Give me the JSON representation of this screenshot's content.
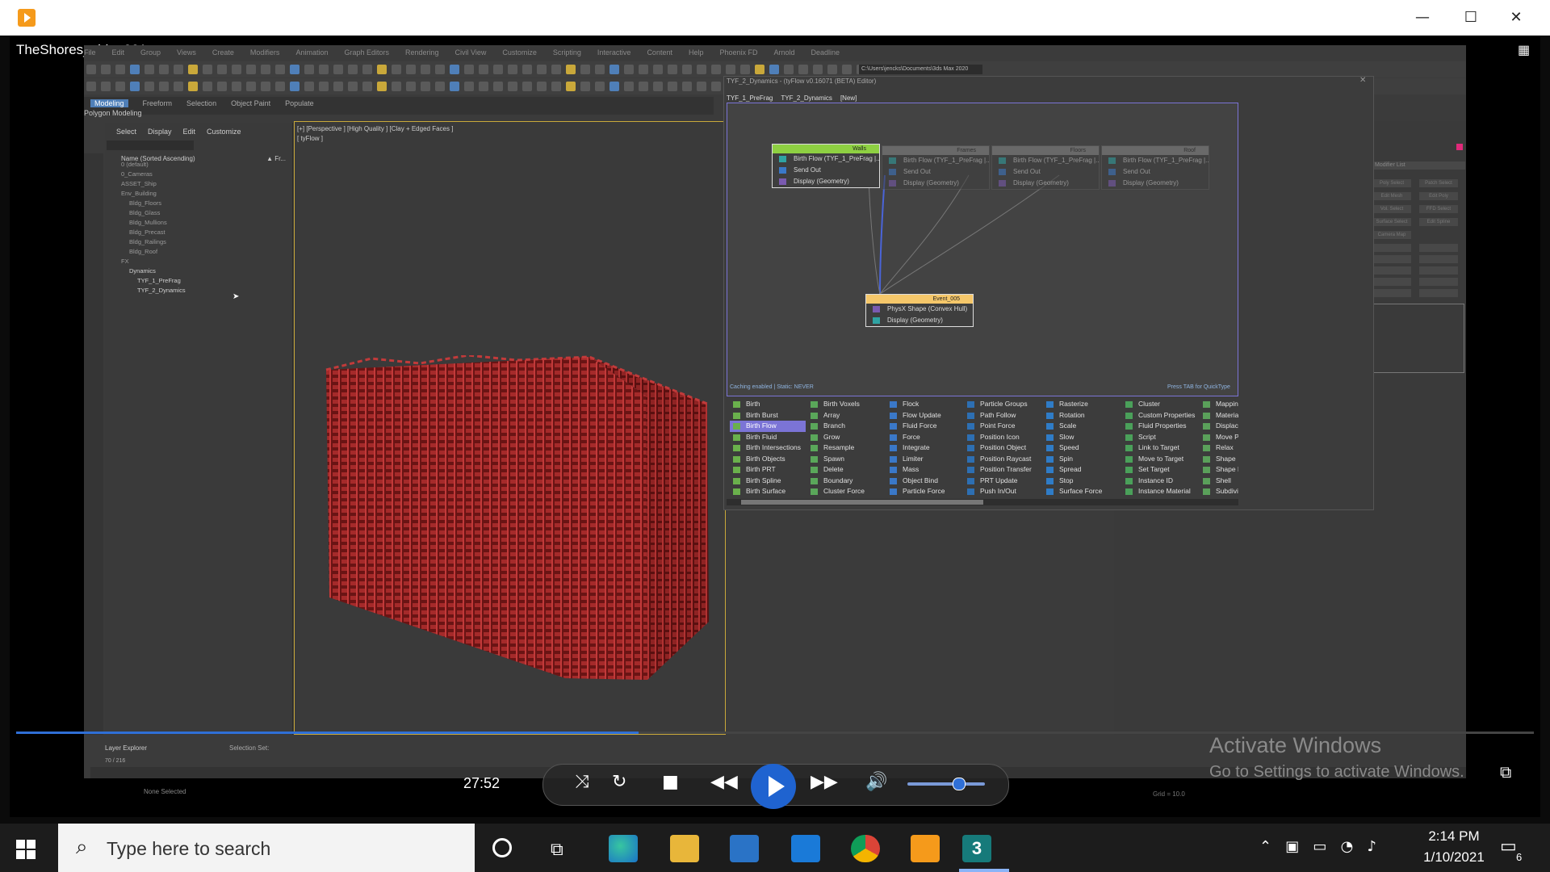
{
  "window": {
    "minimize": "—",
    "maximize": "☐",
    "close": "✕"
  },
  "video": {
    "title": "TheShores_video001",
    "time": "27:52",
    "progress_fraction": 0.41
  },
  "max": {
    "menu": [
      "File",
      "Edit",
      "Group",
      "Views",
      "Create",
      "Modifiers",
      "Animation",
      "Graph Editors",
      "Rendering",
      "Civil View",
      "Customize",
      "Scripting",
      "Interactive",
      "Content",
      "Help",
      "Phoenix FD",
      "Arnold",
      "Deadline"
    ],
    "ribbon": [
      "Modeling",
      "Freeform",
      "Selection",
      "Object Paint",
      "Populate"
    ],
    "polygon_modeling": "Polygon Modeling",
    "path": "C:\\Users\\jencks\\Documents\\3ds Max 2020",
    "scene_explorer": {
      "tabs": [
        "Select",
        "Display",
        "Edit",
        "Customize"
      ],
      "header": "Name (Sorted Ascending)",
      "header_right": "▲ Fr...",
      "rows": [
        "0 (default)",
        "0_Cameras",
        "ASSET_Ship",
        "Env_Building",
        "Bldg_Floors",
        "Bldg_Glass",
        "Bldg_Mullions",
        "Bldg_Precast",
        "Bldg_Railings",
        "Bldg_Roof",
        "FX",
        "Dynamics",
        "TYF_1_PreFrag",
        "TYF_2_Dynamics"
      ]
    },
    "viewport_label": "[+] [Perspective ] [High Quality ] [Clay + Edged Faces ]",
    "viewport_sub": "[ tyFlow ]",
    "right_panel": {
      "modifier_list": "Modifier List",
      "buttons": [
        "Poly Select",
        "Patch Select",
        "Edit Mesh",
        "Edit Poly",
        "Vol. Select",
        "FFD Select",
        "Surface Select",
        "Edit Spline",
        "Camera Map"
      ]
    },
    "layer_explorer": "Layer Explorer",
    "selection_set": "Selection Set:",
    "frame_counter": "70 / 216",
    "status": "None Selected",
    "grid": "Grid = 10.0"
  },
  "tyflow": {
    "title": "TYF_2_Dynamics - (tyFlow v0.16071 (BETA) Editor)",
    "tabs": [
      "TYF_1_PreFrag",
      "TYF_2_Dynamics",
      "[New]"
    ],
    "nodes": [
      {
        "name": "Walls",
        "ops": [
          "Birth Flow (TYF_1_PreFrag |...",
          "Send Out",
          "Display (Geometry)"
        ]
      },
      {
        "name": "Frames",
        "ops": [
          "Birth Flow (TYF_1_PreFrag |...",
          "Send Out",
          "Display (Geometry)"
        ]
      },
      {
        "name": "Floors",
        "ops": [
          "Birth Flow (TYF_1_PreFrag |...",
          "Send Out",
          "Display (Geometry)"
        ]
      },
      {
        "name": "Roof",
        "ops": [
          "Birth Flow (TYF_1_PreFrag |...",
          "Send Out",
          "Display (Geometry)"
        ]
      },
      {
        "name": "Event_005",
        "ops": [
          "PhysX Shape (Convex Hull)",
          "Display (Geometry)"
        ]
      }
    ],
    "status": "Caching enabled | Static: NEVER",
    "hint": "Press TAB for QuickType",
    "depot": [
      [
        "Birth",
        "Birth Burst",
        "Birth Flow",
        "Birth Fluid",
        "Birth Intersections",
        "Birth Objects",
        "Birth PRT",
        "Birth Spline",
        "Birth Surface"
      ],
      [
        "Birth Voxels",
        "Array",
        "Branch",
        "Grow",
        "Resample",
        "Spawn",
        "Delete",
        "Boundary",
        "Cluster Force"
      ],
      [
        "Flock",
        "Flow Update",
        "Fluid Force",
        "Force",
        "Integrate",
        "Limiter",
        "Mass",
        "Object Bind",
        "Particle Force"
      ],
      [
        "Particle Groups",
        "Path Follow",
        "Point Force",
        "Position Icon",
        "Position Object",
        "Position Raycast",
        "Position Transfer",
        "PRT Update",
        "Push In/Out"
      ],
      [
        "Rasterize",
        "Rotation",
        "Scale",
        "Slow",
        "Speed",
        "Spin",
        "Spread",
        "Stop",
        "Surface Force"
      ],
      [
        "Cluster",
        "Custom Properties",
        "Fluid Properties",
        "Script",
        "Link to Target",
        "Move to Target",
        "Set Target",
        "Instance ID",
        "Instance Material"
      ],
      [
        "Mapping",
        "Material",
        "Displace",
        "Move Pi",
        "Relax",
        "Shape",
        "Shape Re",
        "Shell",
        "Subdivid"
      ]
    ],
    "selected_depot_item": "Birth Flow"
  },
  "watermark": {
    "line1": "Activate Windows",
    "line2": "Go to Settings to activate Windows."
  },
  "taskbar": {
    "search_placeholder": "Type here to search",
    "time": "2:14 PM",
    "date": "1/10/2021",
    "notifications": "6"
  },
  "colors": {
    "accent": "#2f6fd6",
    "tyflow_selection": "#7b74d6",
    "building": "#8a1e1e",
    "walls_node": "#8ed042",
    "event_node": "#f5c76a"
  }
}
